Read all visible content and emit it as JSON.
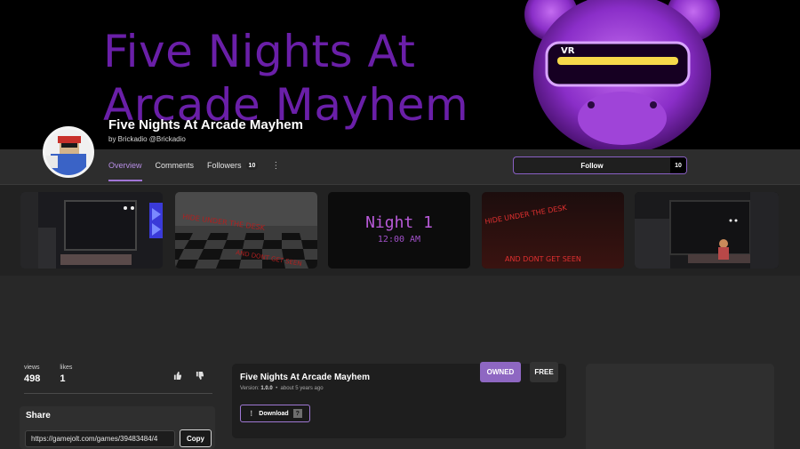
{
  "banner": {
    "title_line1": "Five Nights At",
    "title_line2": "Arcade Mayhem",
    "mascot_icon": "vr-bear-mascot"
  },
  "game": {
    "title": "Five Nights At Arcade Mayhem",
    "byline": "by Brickadio @Brickadio"
  },
  "nav": {
    "overview": "Overview",
    "comments": "Comments",
    "followers": "Followers",
    "followers_count": "10",
    "more_icon": "kebab-icon"
  },
  "follow": {
    "label": "Follow",
    "count": "10"
  },
  "gallery": {
    "thumbs": [
      {
        "kind": "office-screenshot"
      },
      {
        "kind": "checker-floor",
        "text_top": "HIDE UNDER THE DESK",
        "text_bottom": "AND DONT GET SEEN"
      },
      {
        "kind": "night-title",
        "text_top": "Night 1",
        "text_bottom": "12:00 AM"
      },
      {
        "kind": "red-hallway",
        "text_top": "HIDE UNDER THE DESK",
        "text_bottom": "AND DONT GET SEEN"
      },
      {
        "kind": "office-animatronic"
      }
    ]
  },
  "stats": {
    "views_label": "views",
    "views_value": "498",
    "likes_label": "likes",
    "likes_value": "1"
  },
  "share": {
    "title": "Share",
    "url": "https://gamejolt.com/games/39483484/4",
    "copy_label": "Copy"
  },
  "package": {
    "title": "Five Nights At Arcade Mayhem",
    "version_label": "Version:",
    "version_value": "1.0.0",
    "sep": "•",
    "date": "about 5 years ago",
    "owned": "OWNED",
    "free": "FREE",
    "download": "Download",
    "unknown_icon": "?"
  },
  "colors": {
    "accent": "#8e67c2",
    "banner_title": "#6a1fa8",
    "background": "#282828"
  }
}
